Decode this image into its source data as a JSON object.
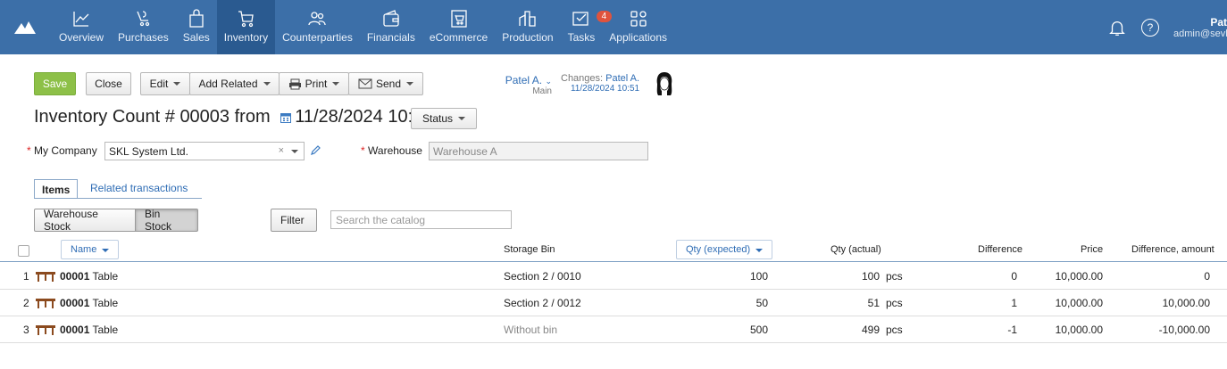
{
  "nav": {
    "items": [
      {
        "label": "Overview",
        "icon": "chart-line-icon"
      },
      {
        "label": "Purchases",
        "icon": "purchases-icon"
      },
      {
        "label": "Sales",
        "icon": "shopping-bag-icon"
      },
      {
        "label": "Inventory",
        "icon": "cart-icon"
      },
      {
        "label": "Counterparties",
        "icon": "people-icon"
      },
      {
        "label": "Financials",
        "icon": "wallet-icon"
      },
      {
        "label": "eCommerce",
        "icon": "ecommerce-icon"
      },
      {
        "label": "Production",
        "icon": "factory-icon"
      },
      {
        "label": "Tasks",
        "icon": "tasks-check-icon",
        "badge": "4"
      },
      {
        "label": "Applications",
        "icon": "apps-grid-icon"
      }
    ],
    "active": "Inventory",
    "help": "?",
    "user_name": "Pat",
    "user_email": "admin@sevk"
  },
  "toolbar": {
    "save": "Save",
    "close": "Close",
    "edit": "Edit",
    "add_related": "Add Related",
    "print": "Print",
    "send": "Send",
    "owner_name": "Patel A.",
    "owner_sub": "Main",
    "changes_label": "Changes:",
    "changes_user": "Patel A.",
    "changes_date": "11/28/2024 10:51"
  },
  "doc": {
    "title_prefix": "Inventory Count #",
    "number": "00003",
    "from": "from",
    "date": "11/28/2024 10:51",
    "status_label": "Status"
  },
  "form": {
    "company_label": "My Company",
    "company_value": "SKL System Ltd.",
    "warehouse_label": "Warehouse",
    "warehouse_value": "Warehouse A"
  },
  "tabs": {
    "items": "Items",
    "related": "Related transactions"
  },
  "filters": {
    "warehouse_stock": "Warehouse Stock",
    "bin_stock": "Bin Stock",
    "filter": "Filter",
    "search_placeholder": "Search the catalog"
  },
  "table": {
    "headers": {
      "name": "Name",
      "storage_bin": "Storage Bin",
      "qty_expected": "Qty (expected)",
      "qty_actual": "Qty (actual)",
      "difference": "Difference",
      "price": "Price",
      "difference_amount": "Difference, amount"
    },
    "rows": [
      {
        "num": "1",
        "code": "00001",
        "name": "Table",
        "bin": "Section 2 / 0010",
        "expected": "100",
        "actual": "100",
        "unit": "pcs",
        "diff": "0",
        "price": "10,000.00",
        "diff_amount": "0"
      },
      {
        "num": "2",
        "code": "00001",
        "name": "Table",
        "bin": "Section 2 / 0012",
        "expected": "50",
        "actual": "51",
        "unit": "pcs",
        "diff": "1",
        "price": "10,000.00",
        "diff_amount": "10,000.00"
      },
      {
        "num": "3",
        "code": "00001",
        "name": "Table",
        "bin": "Without bin",
        "expected": "500",
        "actual": "499",
        "unit": "pcs",
        "diff": "-1",
        "price": "10,000.00",
        "diff_amount": "-10,000.00"
      }
    ]
  }
}
